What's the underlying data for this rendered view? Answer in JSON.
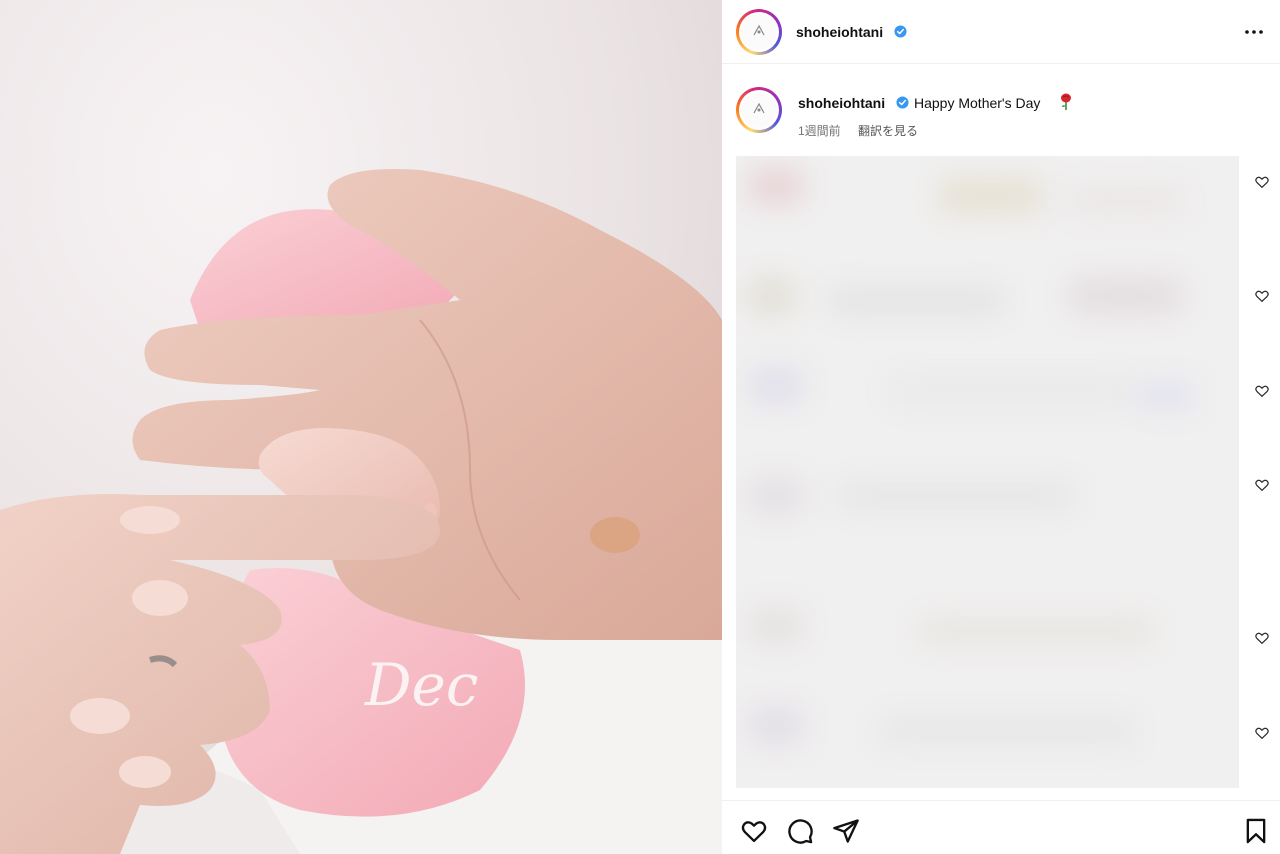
{
  "post": {
    "username": "shoheiohtani",
    "verified": true,
    "caption": "Happy Mother's Day",
    "caption_emoji": "rose-emoji",
    "time_ago": "1週間前",
    "translate_label": "翻訳を見る"
  },
  "icons": {
    "header_more": "more-horizontal-icon",
    "verified": "verified-badge-icon",
    "comment_like": "heart-outline-icon",
    "actions": [
      "heart-icon",
      "comment-icon",
      "share-icon",
      "bookmark-icon"
    ]
  },
  "comments": {
    "blurred": true,
    "like_buttons": 6
  },
  "colors": {
    "verified_blue": "#3897f0",
    "story_ring": [
      "#feda75",
      "#fa7e1e",
      "#d62976",
      "#962fbf",
      "#4f5bd5"
    ],
    "meta_gray": "#737373"
  }
}
